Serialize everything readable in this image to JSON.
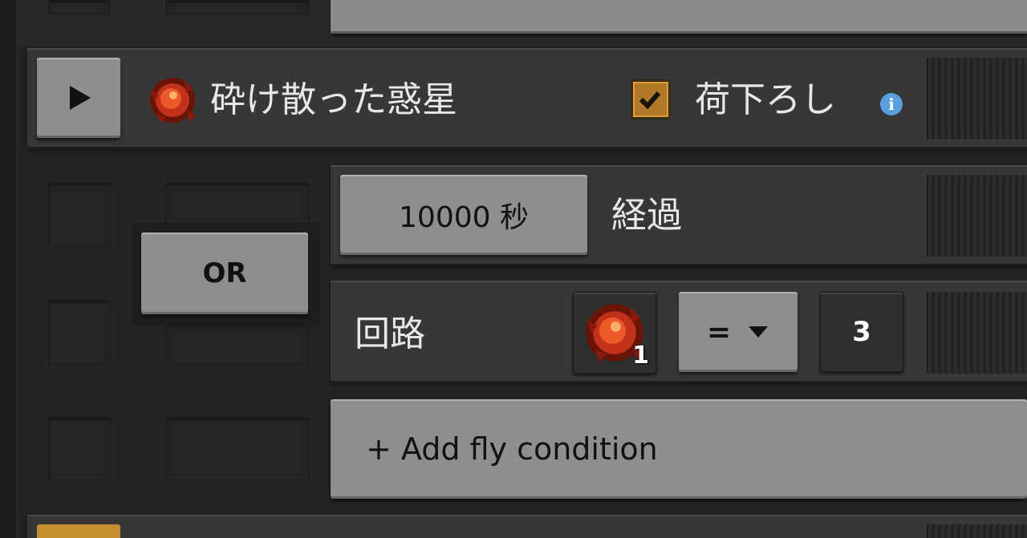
{
  "stop": {
    "planet_name": "砕け散った惑星",
    "unload_label": "荷下ろし",
    "unload_checked": true,
    "info_icon": "info-icon",
    "play_icon": "play-icon",
    "planet_icon": "shattered-planet-icon"
  },
  "conditions": {
    "or_label": "OR",
    "time_button": "10000 秒",
    "time_suffix": "経過",
    "circuit_label": "回路",
    "signal_count": "1",
    "operator": "=",
    "value": "3",
    "add_condition": "+ Add fly condition"
  },
  "colors": {
    "background": "#232323",
    "panel": "#383737",
    "button": "#8e8e8e",
    "checkbox": "#b07a2a",
    "info": "#5aa0e0"
  }
}
